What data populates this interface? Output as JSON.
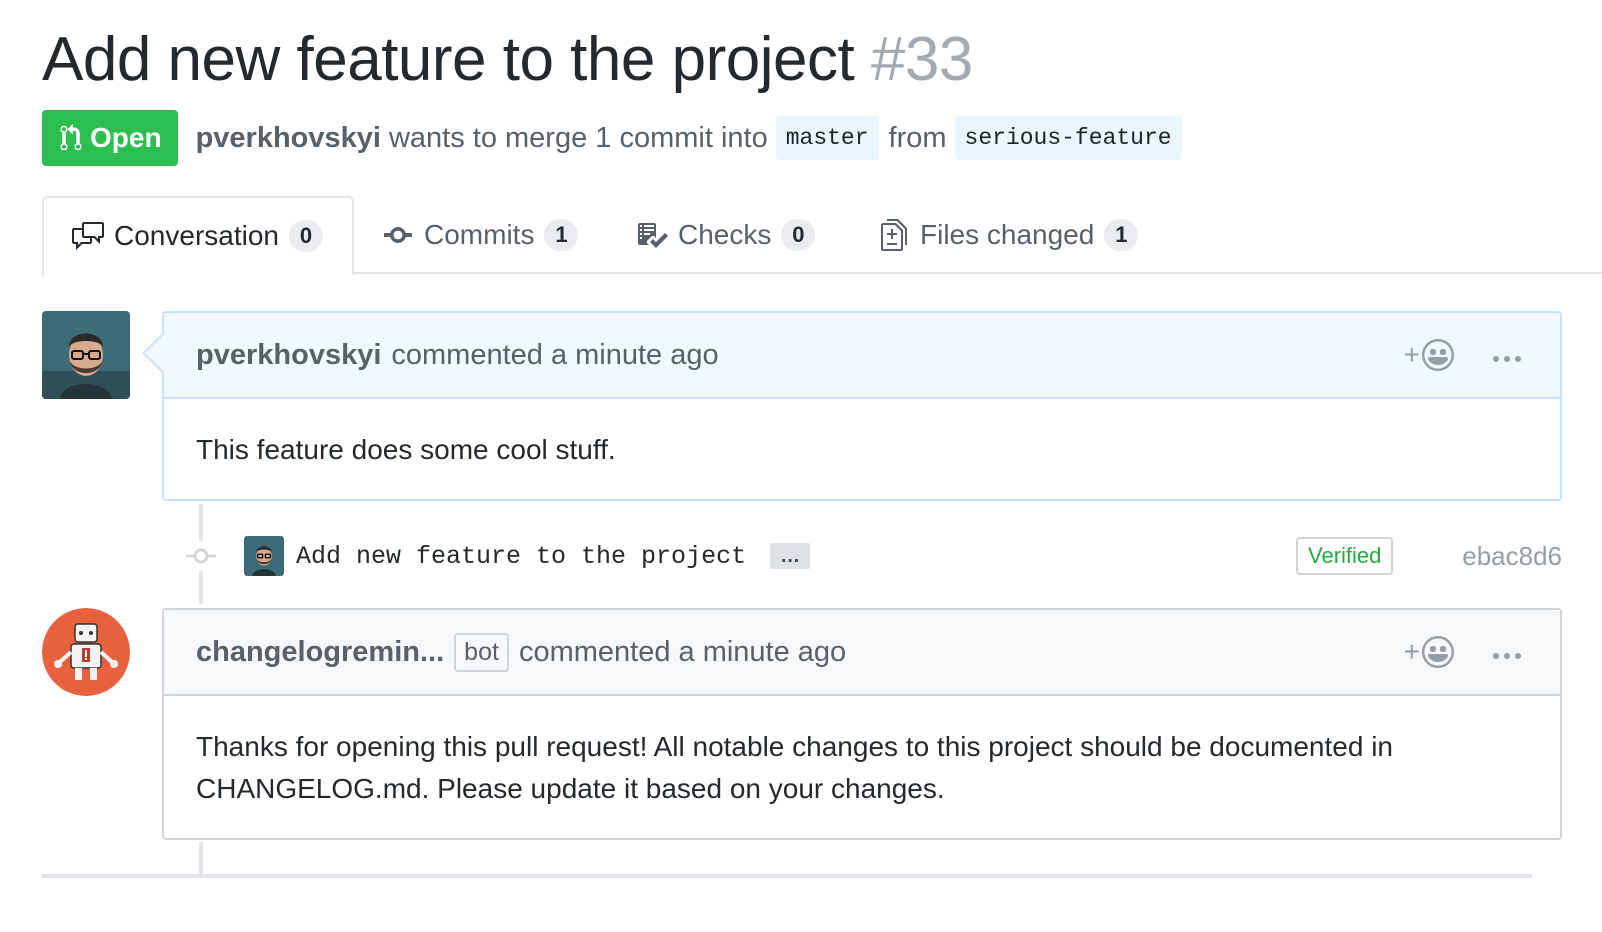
{
  "pull_request": {
    "title": "Add new feature to the project",
    "number": "#33",
    "state": "Open",
    "author": "pverkhovskyi",
    "merge_text": "wants to merge 1 commit into",
    "base_branch": "master",
    "from_text": "from",
    "head_branch": "serious-feature"
  },
  "tabs": [
    {
      "label": "Conversation",
      "count": "0",
      "icon": "comment-discussion-icon"
    },
    {
      "label": "Commits",
      "count": "1",
      "icon": "git-commit-icon"
    },
    {
      "label": "Checks",
      "count": "0",
      "icon": "checklist-icon"
    },
    {
      "label": "Files changed",
      "count": "1",
      "icon": "diff-icon"
    }
  ],
  "comments": [
    {
      "author": "pverkhovskyi",
      "action": "commented a minute ago",
      "body": "This feature does some cool stuff."
    },
    {
      "author": "changelogremin...",
      "badge": "bot",
      "action": "commented a minute ago",
      "body_line1": "Thanks for opening this pull request! All notable changes to this project should be documented in",
      "body_line2": "CHANGELOG.md. Please update it based on your changes."
    }
  ],
  "commit": {
    "message": "Add new feature to the project",
    "expand": "…",
    "verified": "Verified",
    "sha": "ebac8d6"
  },
  "reaction_plus": "+",
  "colors": {
    "open_green": "#2cbe4e",
    "verified_green": "#28a745",
    "branch_bg": "#eaf5ff",
    "own_comment_header": "#f1f8ff"
  }
}
